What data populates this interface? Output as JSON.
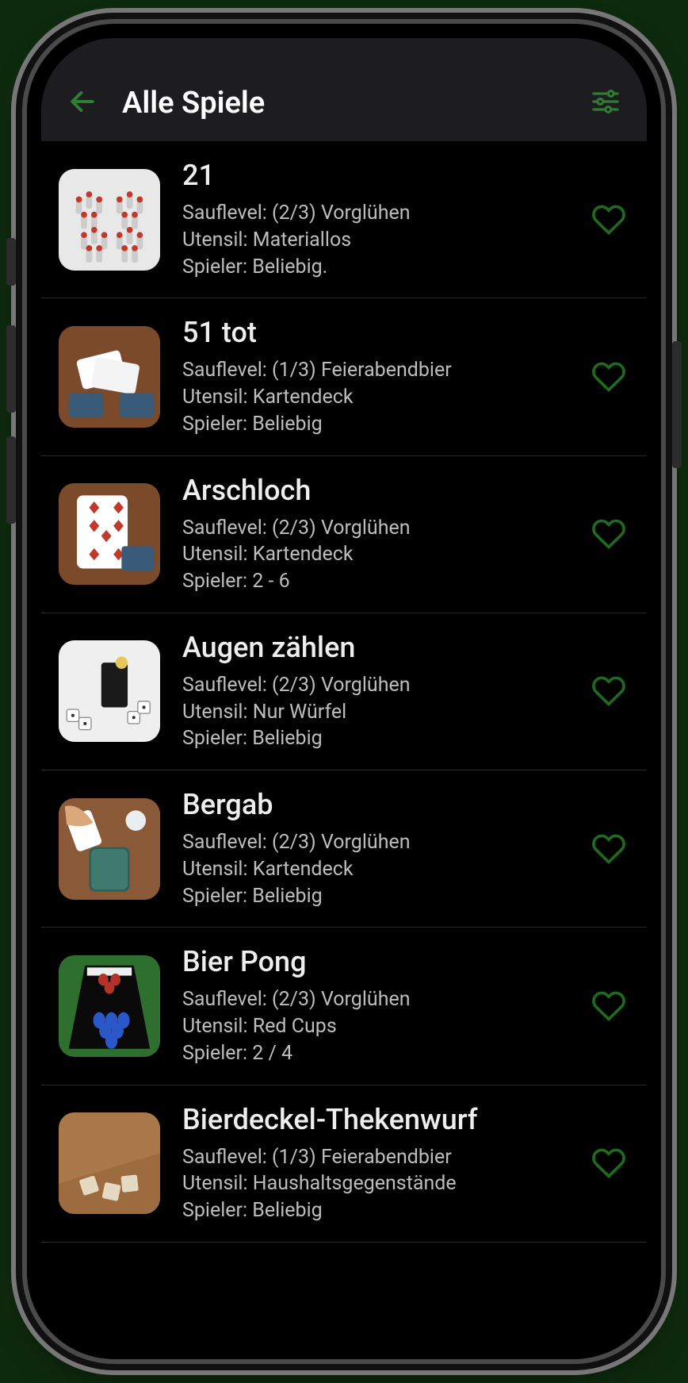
{
  "colors": {
    "accent": "#2e7d32",
    "heart_stroke": "#1f6a1f",
    "header_bg": "#1d1d1f",
    "bg": "#000000"
  },
  "header": {
    "back_icon": "arrow-left-icon",
    "title": "Alle Spiele",
    "filter_icon": "sliders-icon"
  },
  "labels": {
    "sauflevel_prefix": "Sauflevel: ",
    "utensil_prefix": "Utensil: ",
    "spieler_prefix": "Spieler: "
  },
  "games": [
    {
      "title": "21",
      "sauflevel": "(2/3) Vorglühen",
      "utensil": "Materiallos",
      "spieler": "Beliebig.",
      "thumb": "pins"
    },
    {
      "title": "51 tot",
      "sauflevel": "(1/3) Feierabendbier",
      "utensil": "Kartendeck",
      "spieler": "Beliebig",
      "thumb": "cards-pile"
    },
    {
      "title": "Arschloch",
      "sauflevel": "(2/3) Vorglühen",
      "utensil": "Kartendeck",
      "spieler": "2 - 6",
      "thumb": "card-seven"
    },
    {
      "title": "Augen zählen",
      "sauflevel": "(2/3) Vorglühen",
      "utensil": "Nur Würfel",
      "spieler": "Beliebig",
      "thumb": "drink-dice"
    },
    {
      "title": "Bergab",
      "sauflevel": "(2/3) Vorglühen",
      "utensil": "Kartendeck",
      "spieler": "Beliebig",
      "thumb": "hand-cards"
    },
    {
      "title": "Bier Pong",
      "sauflevel": "(2/3) Vorglühen",
      "utensil": "Red Cups",
      "spieler": "2 / 4",
      "thumb": "beerpong"
    },
    {
      "title": "Bierdeckel-Thekenwurf",
      "sauflevel": "(1/3) Feierabendbier",
      "utensil": "Haushaltsgegenstände",
      "spieler": "Beliebig",
      "thumb": "coasters"
    }
  ]
}
